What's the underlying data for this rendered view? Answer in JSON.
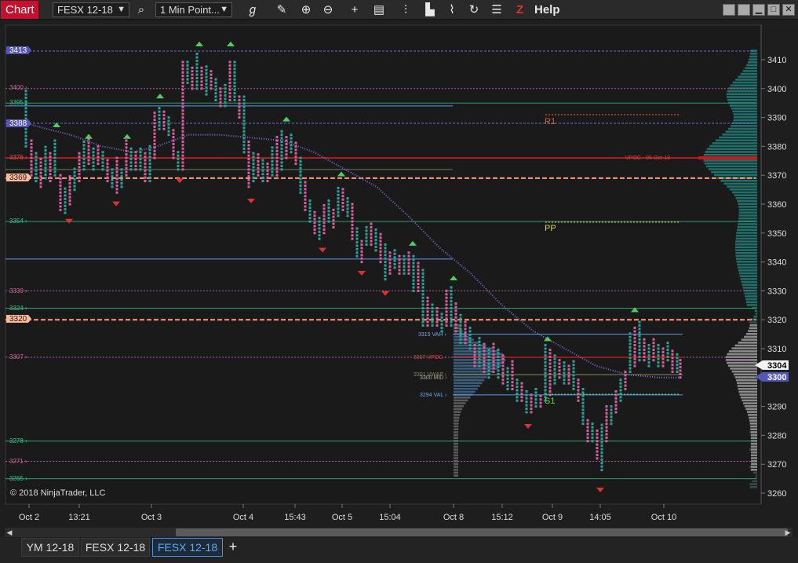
{
  "toolbar": {
    "chart_tab": "Chart",
    "instrument": "FESX 12-18",
    "interval": "1 Min Point...",
    "help_label": "Help",
    "help_icon": "Z"
  },
  "chart": {
    "copyright": "© 2018 NinjaTrader, LLC",
    "price_axis": [
      "3410",
      "3400",
      "3390",
      "3380",
      "3370",
      "3360",
      "3350",
      "3340",
      "3330",
      "3320",
      "3310",
      "3300",
      "3290",
      "3280",
      "3270",
      "3260"
    ],
    "time_axis": [
      "Oct 2",
      "13:21",
      "Oct 3",
      "Oct 4",
      "15:43",
      "Oct 5",
      "15:04",
      "Oct 8",
      "15:12",
      "Oct 9",
      "14:05",
      "Oct 10"
    ],
    "left_level_tags": {
      "tag_3413": "3413",
      "tag_3388": "3388",
      "tag_3369": "3369",
      "tag_3320": "3320"
    },
    "left_level_labels": {
      "l3400": "3400 ›",
      "l3395": "3395 ›",
      "l3376": "3376 ›",
      "l3354": "3354 ›",
      "l3330": "3330 ›",
      "l3324": "3324 ›",
      "l3307": "3307 ›",
      "l3278": "3278 ›",
      "l3271": "3271 ›",
      "l3265": "3265 ›"
    },
    "profile_labels": {
      "vah": "3315 VAH ›",
      "vpoc": "3307 VPOC ›",
      "vwap": "3301 VWAP ›",
      "mid": "3300 MID ›",
      "val": "3294 VAL ›",
      "prior_vpoc": "VPOC - 05-Oct-18"
    },
    "pivot_labels": {
      "r1": "R1",
      "pp": "PP",
      "s1": "S1"
    },
    "current_price_tag": "3304",
    "vwap_price_tag": "3300",
    "colors": {
      "up": "#29a39a",
      "down": "#d75fa0",
      "vwap": "#7a6fd8",
      "red_level": "#e02020",
      "orange_level": "#ff9a7a",
      "tag_purple": "#5656b8",
      "green_level": "#2f9e6a",
      "blue_level": "#5b9cf0"
    }
  },
  "bottom_tabs": {
    "tab1": "YM 12-18",
    "tab2": "FESX 12-18",
    "tab3": "FESX 12-18",
    "add": "+"
  }
}
